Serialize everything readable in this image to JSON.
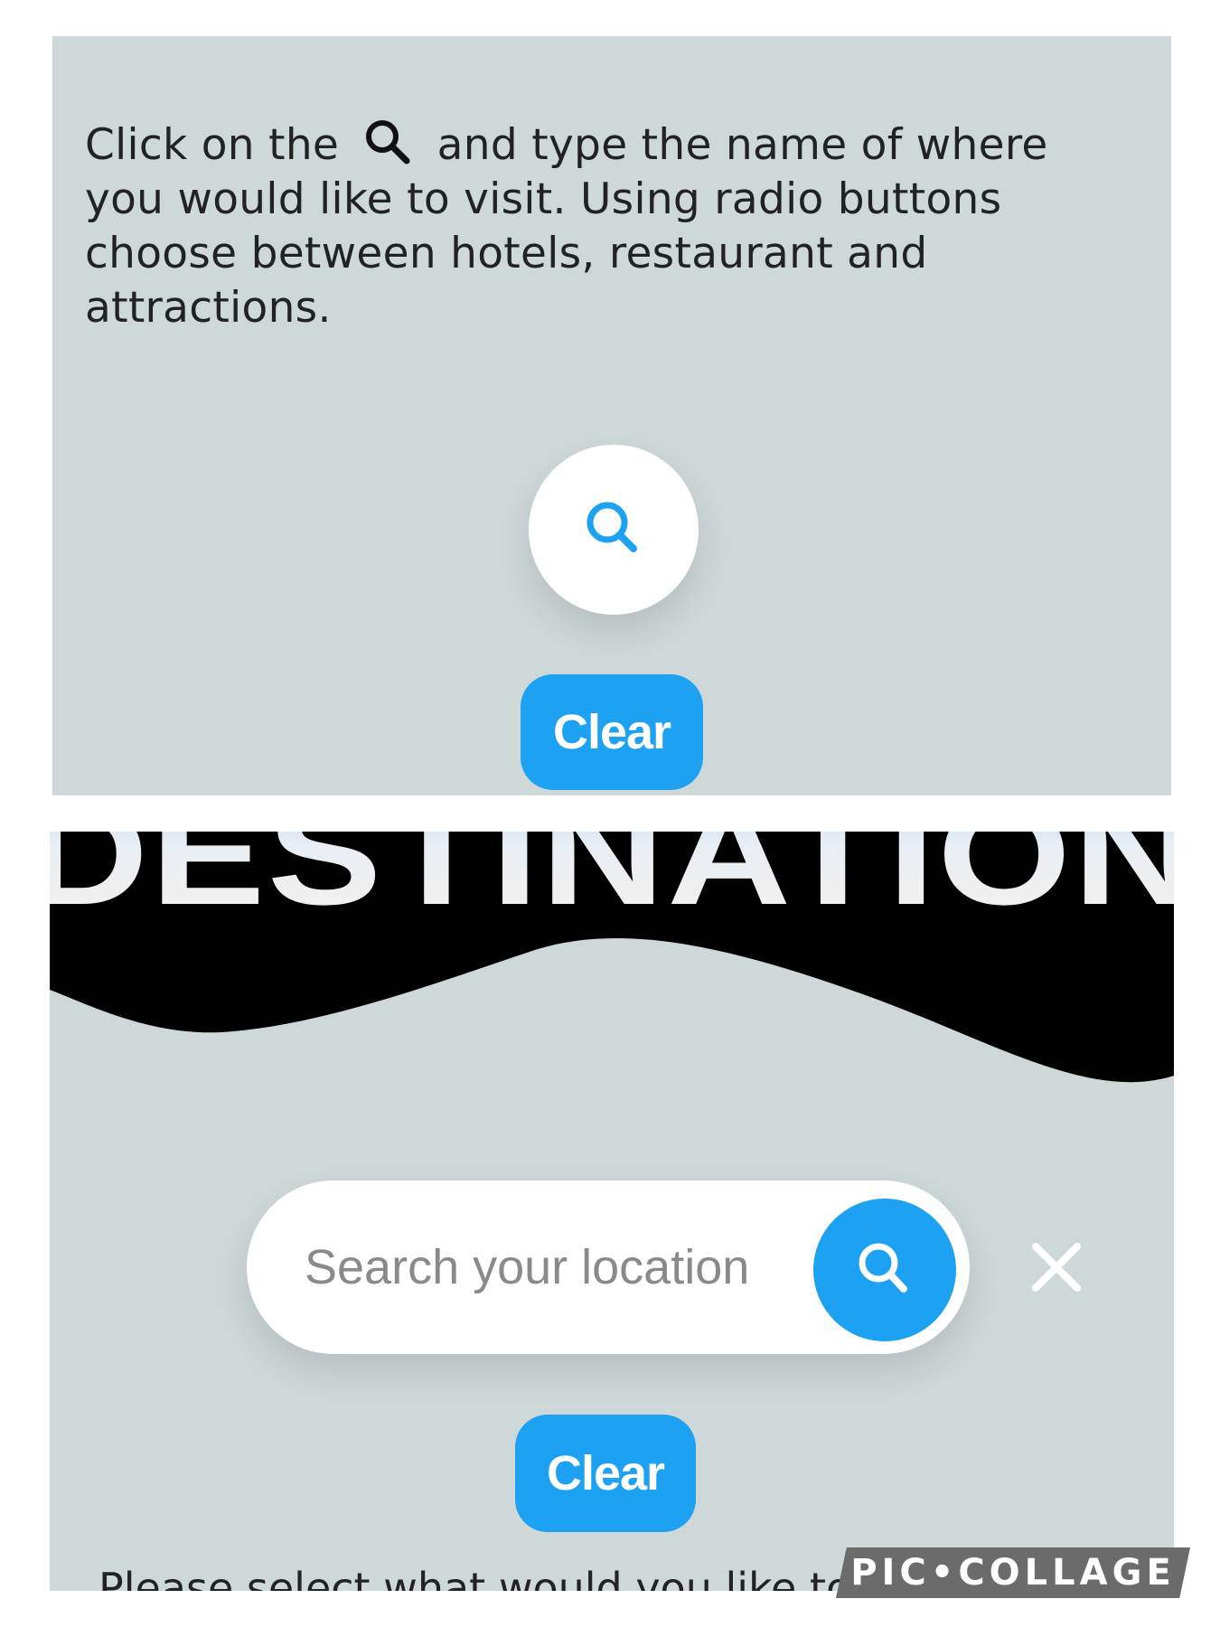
{
  "top_panel": {
    "instructions_before_icon": "Click on the",
    "instructions_after_icon": "and type the name of where you would like to visit. Using radio buttons choose between hotels, restaurant and attractions.",
    "clear_label": "Clear"
  },
  "bottom_panel": {
    "banner_text": "DESTINATION",
    "search_placeholder": "Search your location",
    "clear_label": "Clear",
    "hint_text": "Please select what would you like to see"
  },
  "watermark": "PIC•COLLAGE",
  "colors": {
    "panel_background": "#cfd8d9",
    "accent_blue": "#1da1f2",
    "banner_black": "#000000"
  },
  "icons": {
    "inline": "search-icon",
    "round_button": "search-icon",
    "submit": "search-icon",
    "close": "close-icon"
  }
}
